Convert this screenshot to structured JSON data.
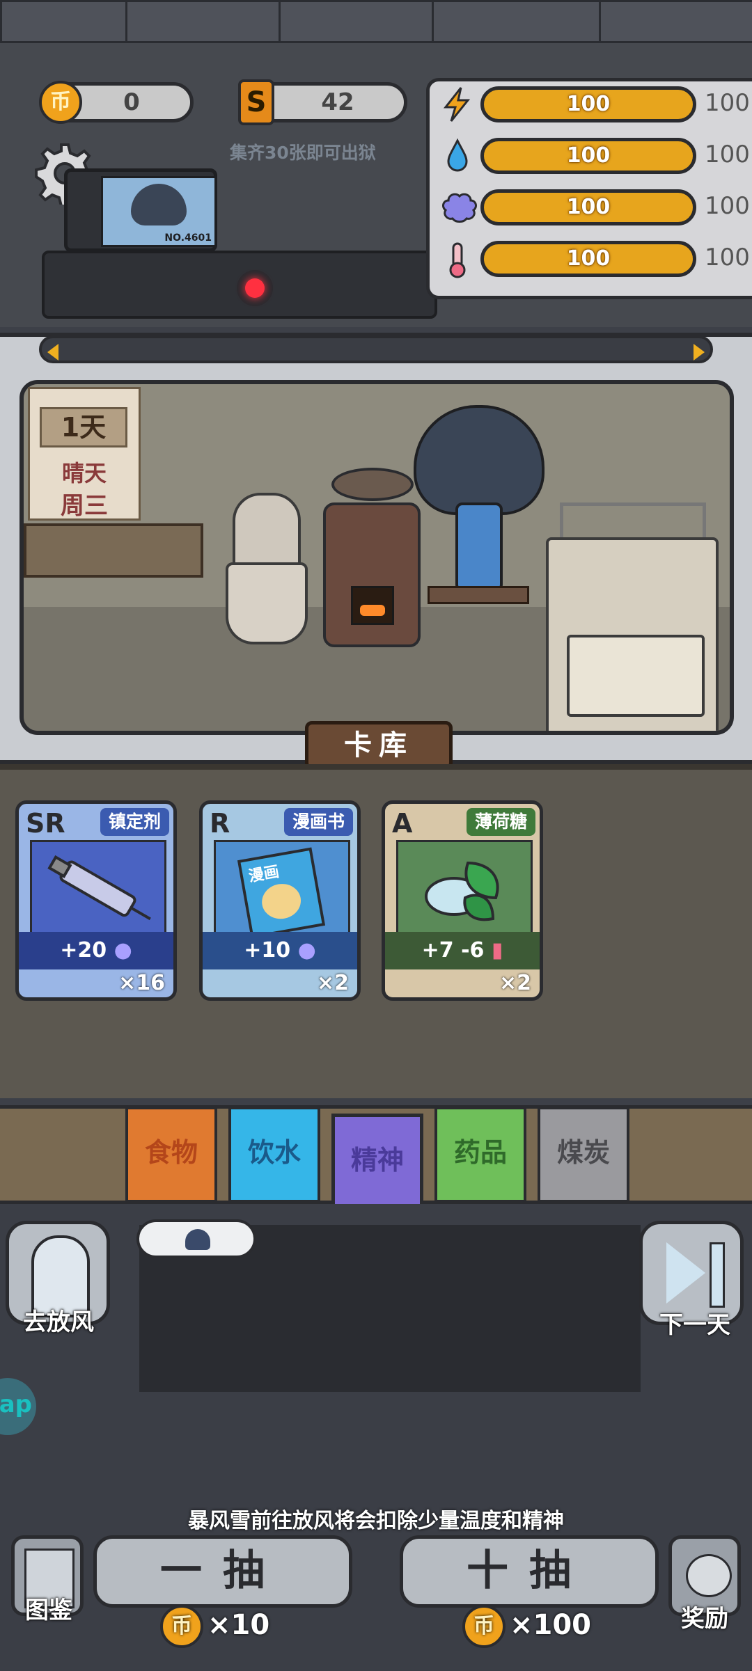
{
  "currency": {
    "coins": "0",
    "coin_icon_label": "币",
    "tokens": "42",
    "token_icon_label": "S"
  },
  "hint": "集齐30张即可出狱",
  "stats": [
    {
      "icon": "energy-icon",
      "value": "100",
      "max": "100"
    },
    {
      "icon": "water-icon",
      "value": "100",
      "max": "100"
    },
    {
      "icon": "brain-icon",
      "value": "100",
      "max": "100"
    },
    {
      "icon": "thermometer-icon",
      "value": "100",
      "max": "100"
    }
  ],
  "prisoner_badge": "NO.4601",
  "calendar": {
    "day": "1天",
    "weather": "晴天",
    "weekday": "周三"
  },
  "card_library_label": "卡库",
  "cards": [
    {
      "rarity": "SR",
      "name": "镇定剂",
      "effect": "+20",
      "count": "×16"
    },
    {
      "rarity": "R",
      "name": "漫画书",
      "art_text": "漫画",
      "effect": "+10",
      "count": "×2"
    },
    {
      "rarity": "A",
      "name": "薄荷糖",
      "effect": "+7  -6",
      "count": "×2"
    }
  ],
  "tabs": [
    "食物",
    "饮水",
    "精神",
    "药品",
    "煤炭"
  ],
  "buttons": {
    "go_out": "去放风",
    "next_day": "下一天",
    "album": "图鉴",
    "reward": "奖励",
    "draw_one": "一抽",
    "draw_ten": "十抽",
    "draw_one_cost": "×10",
    "draw_ten_cost": "×100"
  },
  "side_tag": "ap",
  "warning": "暴风雪前往放风将会扣除少量温度和精神",
  "colors": {
    "accent_gold": "#f0a21c",
    "food": "#e07a30",
    "water": "#35b6e8",
    "spirit": "#7f6ad6",
    "medicine": "#6fbf5a",
    "coal": "#9a9a9e"
  }
}
